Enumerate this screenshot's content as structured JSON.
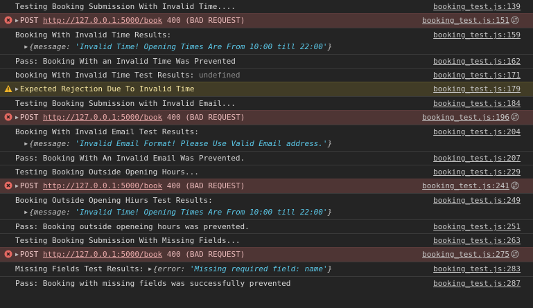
{
  "colors": {
    "background": "#242424",
    "error_row": "#4e3534",
    "warning_row": "#413c26",
    "string_value": "#5bc8e8",
    "object_key": "#c9a6e8"
  },
  "icons": {
    "error": "error-circle-x-icon",
    "warning": "warning-triangle-icon",
    "expand": "expand-triangle-icon",
    "network": "network-request-icon"
  },
  "messages": [
    {
      "type": "log",
      "text": "Testing Booking Submission With Invalid Time....",
      "source": "booking_test.js:139"
    },
    {
      "type": "error",
      "method": "POST",
      "url": "http://127.0.0.1:5000/book",
      "status": "400 (BAD REQUEST)",
      "source": "booking_test.js:151"
    },
    {
      "type": "log",
      "text": "Booking With Invalid Time Results:",
      "source": "booking_test.js:159",
      "object": {
        "key": "message",
        "value": "'Invalid Time! Opening Times Are From 10:00 till 22:00'"
      }
    },
    {
      "type": "log",
      "text": "Pass: Booking With an Invalid Time Was Prevented",
      "source": "booking_test.js:162"
    },
    {
      "type": "log",
      "text": "booking With Invalid Time Test Results:",
      "extra": "undefined",
      "source": "booking_test.js:171"
    },
    {
      "type": "warning",
      "text": "Expected Rejection Due To Invalid Time",
      "source": "booking_test.js:179"
    },
    {
      "type": "log",
      "text": "Testing Booking Submission with Invalid Email...",
      "source": "booking_test.js:184"
    },
    {
      "type": "error",
      "method": "POST",
      "url": "http://127.0.0.1:5000/book",
      "status": "400 (BAD REQUEST)",
      "source": "booking_test.js:196"
    },
    {
      "type": "log",
      "text": "Booking With Invalid Email Test Results:",
      "source": "booking_test.js:204",
      "object": {
        "key": "message",
        "value": "'Invalid Email Format! Please Use Valid Email address.'"
      }
    },
    {
      "type": "log",
      "text": "Pass: Booking With An Invalid Email Was Prevented.",
      "source": "booking_test.js:207"
    },
    {
      "type": "log",
      "text": "Testing Booking Outside Opening Hours...",
      "source": "booking_test.js:229"
    },
    {
      "type": "error",
      "method": "POST",
      "url": "http://127.0.0.1:5000/book",
      "status": "400 (BAD REQUEST)",
      "source": "booking_test.js:241"
    },
    {
      "type": "log",
      "text": "Booking Outside Opening Hiurs Test Results:",
      "source": "booking_test.js:249",
      "object": {
        "key": "message",
        "value": "'Invalid Time! Opening Times Are From 10:00 till 22:00'"
      }
    },
    {
      "type": "log",
      "text": "Pass: Booking outside openeing hours was prevented.",
      "source": "booking_test.js:251"
    },
    {
      "type": "log",
      "text": "Testing Booking Submission With Missing Fields...",
      "source": "booking_test.js:263"
    },
    {
      "type": "error",
      "method": "POST",
      "url": "http://127.0.0.1:5000/book",
      "status": "400 (BAD REQUEST)",
      "source": "booking_test.js:275"
    },
    {
      "type": "log",
      "text": "Missing Fields Test Results:",
      "source": "booking_test.js:283",
      "inline_object": {
        "key": "error",
        "value": "'Missing required field: name'"
      }
    },
    {
      "type": "log",
      "text": "Pass: Booking with missing fields was successfully prevented",
      "source": "booking_test.js:287"
    }
  ]
}
